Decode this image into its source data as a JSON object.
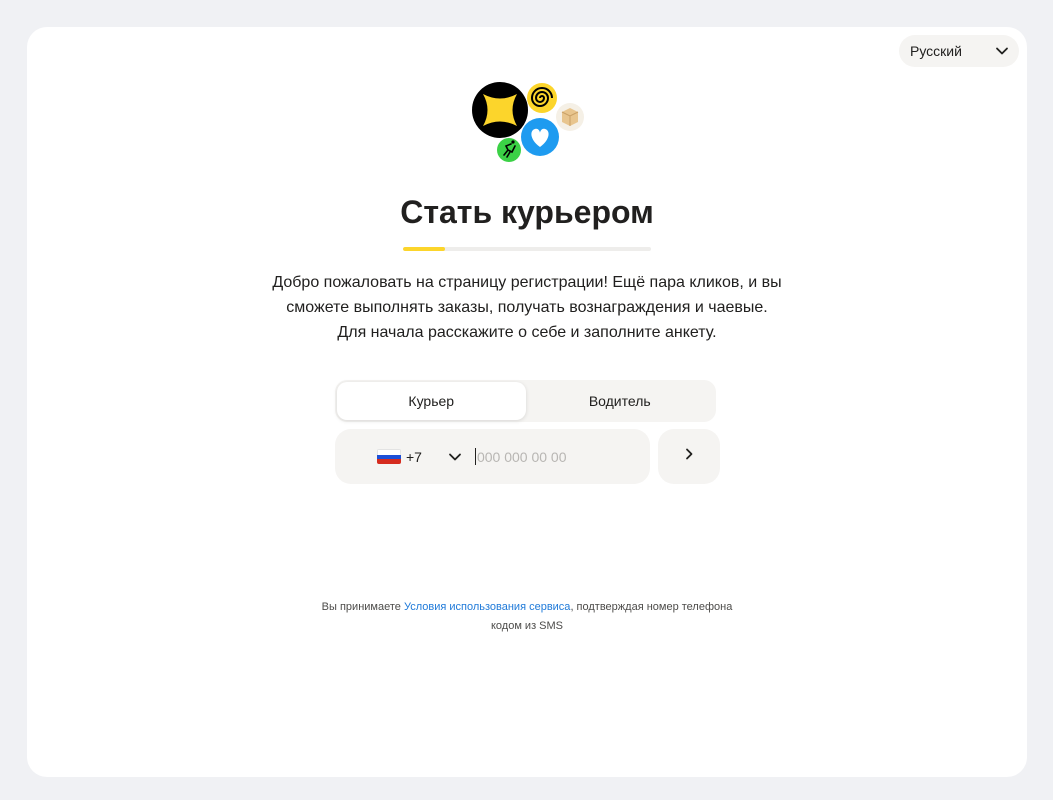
{
  "language_selector": {
    "value": "Русский",
    "icon": "chevron-down-icon"
  },
  "logo": {
    "icons": [
      "yandex-pro-star-icon",
      "spiral-icon",
      "box-icon",
      "heart-icon",
      "running-figure-icon"
    ],
    "colors": {
      "yellow": "#fcd52b",
      "black": "#000000",
      "blue": "#1e9bf0",
      "green": "#3bd146"
    }
  },
  "title": "Стать курьером",
  "progress": {
    "value": 0.17,
    "fill_color": "#fcd52b"
  },
  "intro": {
    "line1": "Добро пожаловать на страницу регистрации! Ещё пара кликов, и вы",
    "line2": "сможете выполнять заказы, получать вознаграждения и чаевые.",
    "line3": "Для начала расскажите о себе и заполните анкету."
  },
  "role_tabs": {
    "courier": "Курьер",
    "driver": "Водитель",
    "selected": "Курьер"
  },
  "phone": {
    "country_flag": "russia-flag-icon",
    "country_code": "+7",
    "placeholder": "000 000 00 00",
    "value": ""
  },
  "next_button": {
    "icon": "chevron-right-icon"
  },
  "terms": {
    "prefix": "Вы принимаете ",
    "link": "Условия использования сервиса",
    "suffix": ", подтверждая номер телефона",
    "line2": "кодом из SMS"
  }
}
